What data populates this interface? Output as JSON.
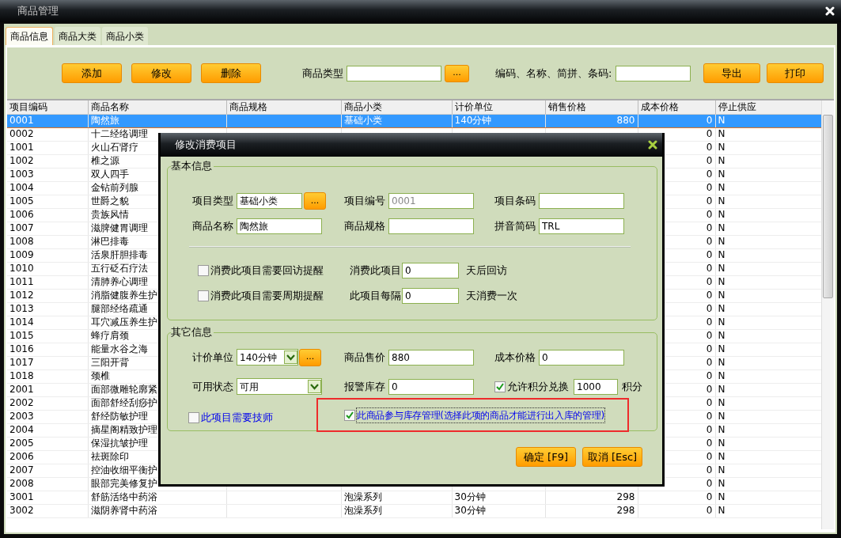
{
  "window": {
    "title": "商品管理"
  },
  "tabs": [
    {
      "label": "商品信息",
      "selected": true
    },
    {
      "label": "商品大类",
      "selected": false
    },
    {
      "label": "商品小类",
      "selected": false
    }
  ],
  "toolbar": {
    "buttons": [
      "添加",
      "修改",
      "删除"
    ],
    "category_label": "商品类型",
    "browse_button": "...",
    "search_label": "编码、名称、简拼、条码:",
    "right_buttons": [
      "导出",
      "打印"
    ]
  },
  "table": {
    "columns": [
      "项目编码",
      "商品名称",
      "商品规格",
      "商品小类",
      "计价单位",
      "销售价格",
      "成本价格",
      "停止供应"
    ],
    "rows": [
      {
        "selected": true,
        "code": "0001",
        "name": "陶然旅",
        "category": "基础小类",
        "unit": "140分钟",
        "price": "880",
        "cost": "0",
        "stop": "N"
      },
      {
        "selected": false,
        "code": "0002",
        "name": "十二经络调理",
        "cost": "0",
        "stop": "N"
      },
      {
        "selected": false,
        "code": "1001",
        "name": "火山石肾疗",
        "cost": "0",
        "stop": "N"
      },
      {
        "selected": false,
        "code": "1002",
        "name": "椎之源",
        "cost": "0",
        "stop": "N"
      },
      {
        "selected": false,
        "code": "1003",
        "name": "双人四手",
        "cost": "0",
        "stop": "N"
      },
      {
        "selected": false,
        "code": "1004",
        "name": "金钻前列腺",
        "cost": "0",
        "stop": "N"
      },
      {
        "selected": false,
        "code": "1005",
        "name": "世爵之貌",
        "cost": "0",
        "stop": "N"
      },
      {
        "selected": false,
        "code": "1006",
        "name": "贵族风情",
        "cost": "0",
        "stop": "N"
      },
      {
        "selected": false,
        "code": "1007",
        "name": "滋脾健胃调理",
        "cost": "0",
        "stop": "N"
      },
      {
        "selected": false,
        "code": "1008",
        "name": "淋巴排毒",
        "cost": "0",
        "stop": "N"
      },
      {
        "selected": false,
        "code": "1009",
        "name": "活泉肝胆排毒",
        "cost": "0",
        "stop": "N"
      },
      {
        "selected": false,
        "code": "1010",
        "name": "五行砭石疗法",
        "cost": "0",
        "stop": "N"
      },
      {
        "selected": false,
        "code": "1011",
        "name": "清肺养心调理",
        "cost": "0",
        "stop": "N"
      },
      {
        "selected": false,
        "code": "1012",
        "name": "消脂健腹养生护",
        "cost": "0",
        "stop": "N"
      },
      {
        "selected": false,
        "code": "1013",
        "name": "腿部经络疏通",
        "cost": "0",
        "stop": "N"
      },
      {
        "selected": false,
        "code": "1014",
        "name": "耳穴减压养生护",
        "cost": "0",
        "stop": "N"
      },
      {
        "selected": false,
        "code": "1015",
        "name": "蜂疗肩颈",
        "cost": "0",
        "stop": "N"
      },
      {
        "selected": false,
        "code": "1016",
        "name": "能量水谷之海",
        "cost": "0",
        "stop": "N"
      },
      {
        "selected": false,
        "code": "1017",
        "name": "三阳开背",
        "cost": "0",
        "stop": "N"
      },
      {
        "selected": false,
        "code": "1018",
        "name": "颈椎",
        "cost": "0",
        "stop": "N"
      },
      {
        "selected": false,
        "code": "2001",
        "name": "面部微雕轮廓紧",
        "cost": "0",
        "stop": "N"
      },
      {
        "selected": false,
        "code": "2002",
        "name": "面部舒经刮痧护",
        "cost": "0",
        "stop": "N"
      },
      {
        "selected": false,
        "code": "2003",
        "name": "舒经防敏护理",
        "cost": "0",
        "stop": "N"
      },
      {
        "selected": false,
        "code": "2004",
        "name": "摘星阁精致护理",
        "cost": "0",
        "stop": "N"
      },
      {
        "selected": false,
        "code": "2005",
        "name": "保湿抗皱护理",
        "cost": "0",
        "stop": "N"
      },
      {
        "selected": false,
        "code": "2006",
        "name": "祛斑除印",
        "cost": "0",
        "stop": "N"
      },
      {
        "selected": false,
        "code": "2007",
        "name": "控油收细平衡护",
        "cost": "0",
        "stop": "N"
      },
      {
        "selected": false,
        "code": "2008",
        "name": "眼部完美修复护",
        "cost": "0",
        "stop": "N"
      },
      {
        "selected": false,
        "code": "3001",
        "name": "舒筋活络中药浴",
        "category": "泡澡系列",
        "unit": "30分钟",
        "price": "298",
        "cost": "0",
        "stop": "N"
      },
      {
        "selected": false,
        "code": "3002",
        "name": "滋阴养肾中药浴",
        "category": "泡澡系列",
        "unit": "30分钟",
        "price": "298",
        "cost": "0",
        "stop": "N"
      }
    ]
  },
  "dialog": {
    "title": "修改消费项目",
    "basic": {
      "legend": "基本信息",
      "fields": [
        {
          "label": "项目类型",
          "value": "基础小类",
          "browse": "..."
        },
        {
          "label": "项目编号",
          "value": "0001",
          "disabled": true
        },
        {
          "label": "项目条码"
        },
        {
          "label": "商品名称",
          "value": "陶然旅"
        },
        {
          "label": "商品规格"
        },
        {
          "label": "拼音简码",
          "value": "TRL"
        }
      ],
      "reminders": [
        {
          "label": "消费此项目需要回访提醒",
          "checked": false,
          "prefix": "消费此项目",
          "value": "0",
          "suffix": "天后回访"
        },
        {
          "label": "消费此项目需要周期提醒",
          "checked": false,
          "prefix": "此项目每隔",
          "value": "0",
          "suffix": "天消费一次"
        }
      ]
    },
    "other": {
      "legend": "其它信息",
      "fields": [
        {
          "kind": "select",
          "label": "计价单位",
          "value": "140分钟",
          "browse": "..."
        },
        {
          "kind": "text",
          "label": "商品售价",
          "value": "880"
        },
        {
          "kind": "text",
          "label": "成本价格",
          "value": "0"
        },
        {
          "kind": "select",
          "label": "可用状态",
          "value": "可用"
        },
        {
          "kind": "text",
          "label": "报警库存",
          "value": "0"
        },
        {
          "kind": "check-input",
          "label": "允许积分兑换",
          "checked": true,
          "value": "1000",
          "suffix": "积分"
        }
      ],
      "options": [
        {
          "label": "此项目需要技师",
          "checked": false,
          "highlighted": false
        },
        {
          "label": "此商品参与库存管理(选择此项的商品才能进行出入库的管理)",
          "checked": true,
          "highlighted": true
        }
      ]
    },
    "buttons": [
      "确定 [F9]",
      "取消 [Esc]"
    ]
  }
}
